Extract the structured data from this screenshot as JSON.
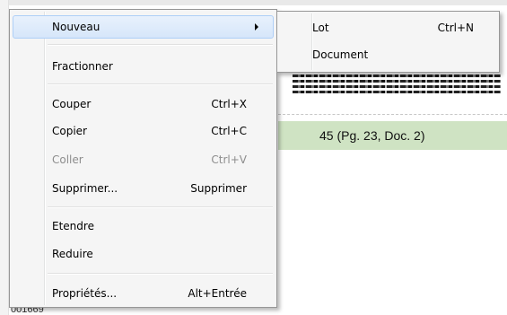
{
  "background": {
    "selected_row_text": "45 (Pg. 23, Doc. 2)",
    "bottom_text": "001669"
  },
  "context_menu": {
    "items": [
      {
        "label": "Nouveau",
        "accel": "",
        "has_submenu": true,
        "highlighted": true
      },
      {
        "label": "Fractionner",
        "accel": ""
      },
      {
        "label": "Couper",
        "accel": "Ctrl+X"
      },
      {
        "label": "Copier",
        "accel": "Ctrl+C"
      },
      {
        "label": "Coller",
        "accel": "Ctrl+V",
        "disabled": true
      },
      {
        "label": "Supprimer...",
        "accel": "Supprimer"
      },
      {
        "label": "Etendre",
        "accel": ""
      },
      {
        "label": "Reduire",
        "accel": ""
      },
      {
        "label": "Propriétés...",
        "accel": "Alt+Entrée"
      }
    ]
  },
  "submenu": {
    "items": [
      {
        "label": "Lot",
        "accel": "Ctrl+N"
      },
      {
        "label": "Document",
        "accel": ""
      }
    ]
  },
  "colors": {
    "menu_background": "#f5f5f5",
    "menu_border": "#979797",
    "highlight_border": "#aecff7",
    "selected_row": "#cfe3c3",
    "disabled_text": "#8d8d8d"
  }
}
